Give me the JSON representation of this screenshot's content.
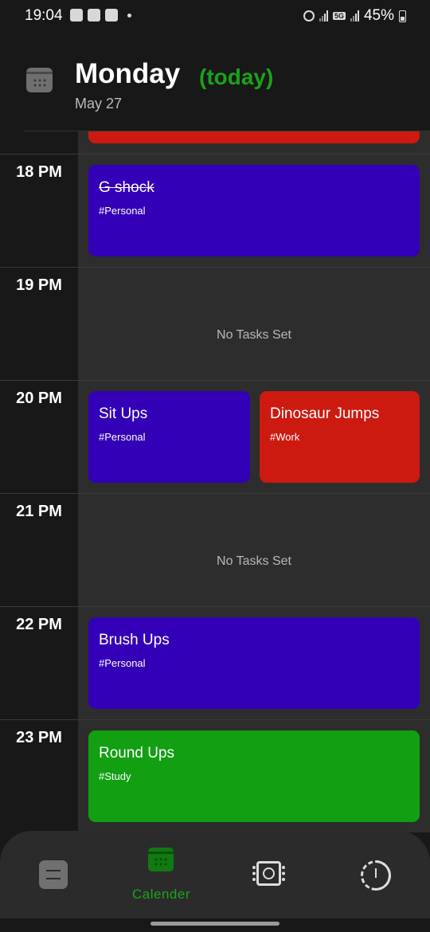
{
  "status_bar": {
    "time": "19:04",
    "network": "5G",
    "battery": "45%"
  },
  "header": {
    "day": "Monday",
    "today": "(today)",
    "date": "May 27"
  },
  "timeline": {
    "no_tasks_text": "No Tasks Set",
    "hours": [
      {
        "label": "18 PM",
        "tasks": [
          {
            "title": "G shock",
            "tag": "#Personal",
            "color": "#3300b8",
            "done": true
          }
        ]
      },
      {
        "label": "19 PM",
        "tasks": []
      },
      {
        "label": "20 PM",
        "tasks": [
          {
            "title": "Sit Ups",
            "tag": "#Personal",
            "color": "#3300b8",
            "done": false
          },
          {
            "title": "Dinosaur Jumps",
            "tag": "#Work",
            "color": "#cc1a10",
            "done": false
          }
        ]
      },
      {
        "label": "21 PM",
        "tasks": []
      },
      {
        "label": "22 PM",
        "tasks": [
          {
            "title": "Brush Ups",
            "tag": "#Personal",
            "color": "#3300b8",
            "done": false
          }
        ]
      },
      {
        "label": "23 PM",
        "tasks": [
          {
            "title": "Round Ups",
            "tag": "#Study",
            "color": "#129f12",
            "done": false
          }
        ]
      }
    ]
  },
  "bottom_nav": {
    "items": [
      {
        "icon": "tasks-icon",
        "label": ""
      },
      {
        "icon": "calendar-icon",
        "label": "Calender",
        "active": true
      },
      {
        "icon": "chip-icon",
        "label": ""
      },
      {
        "icon": "dial-icon",
        "label": ""
      }
    ]
  },
  "colors": {
    "accent": "#1aa21a",
    "purple": "#3300b8",
    "red": "#cc1a10",
    "green": "#129f12"
  }
}
